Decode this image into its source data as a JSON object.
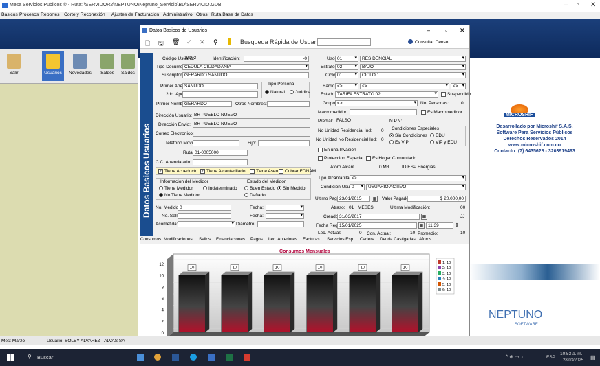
{
  "window": {
    "title": "Mesa Servicios Publicos ® - Ruta: \\SERVIDOR2\\NEPTUNO\\Neptuno_Servicio\\BD\\SERVICIO.GDB"
  },
  "menu": [
    "Basicos",
    "Procesos",
    "Reportes",
    "Corte y Reconexión",
    "Ajustes de Facturacion",
    "Administrativo",
    "Otros",
    "Ruta Base de Datos"
  ],
  "toolbar": [
    {
      "label": "Salir",
      "icon": "exit-icon"
    },
    {
      "label": "Usuarios",
      "icon": "users-icon"
    },
    {
      "label": "Novedades",
      "icon": "news-icon"
    },
    {
      "label": "Saldos",
      "icon": "balance-icon"
    },
    {
      "label": "Saldos",
      "icon": "balance-icon"
    }
  ],
  "dialog": {
    "title": "Datos Basicos de Usuarios",
    "quick_search_label": "Busqueda Rápida de Usuario",
    "consult_census": "Consultar Censo",
    "side_title": "Datos Basicos Usuarios",
    "left": {
      "codigo_label": "Código Usuario:",
      "codigo": "00002",
      "identificacion_label": "Identificación:",
      "ident_suffix": "-0",
      "tipo_doc_label": "Tipo Documento:",
      "tipo_doc": "CEDULA CIUDADANIA",
      "suscriptor_label": "Suscriptor:",
      "suscriptor": "GERARDO SAÑUDO",
      "primer_apellido_label": "Primer Apellido:",
      "primer_apellido": "SAÑUDO",
      "segundo_apellido_label": "2do. Apellido:",
      "primer_nombre_label": "Primer Nombre:",
      "primer_nombre": "GERARDO",
      "otros_nombres_label": "Otros Nombres:",
      "tipo_persona_label": "Tipo Persona",
      "natural": "Natural",
      "juridica": "Juridica",
      "direccion_label": "Dirección Usuario:",
      "direccion": "BR PUEBLO NUEVO",
      "envio_label": "Dirección Envio:",
      "envio": "BR PUEBLO NUEVO",
      "correo_label": "Correo Electronico:",
      "movil_label": "Teléfono Movil:",
      "fijo_label": "Fijo:",
      "ruta_label": "Ruta:",
      "ruta": "01-0005000",
      "cc_label": "C.C. Arrendatario:",
      "chk_acueducto": "Tiene Acueducto",
      "chk_alcantarillado": "Tiene Alcantarillado",
      "chk_aseo": "Tiene Aseo",
      "chk_fonam": "Cobrar FONAM",
      "info_medidor_label": "Informacion del Medidor",
      "tiene_medidor": "Tiene Medidor",
      "indeterminado": "Indeterminado",
      "no_tiene_medidor": "No Tiene Medidor",
      "estado_medidor_label": "Estado del Medidor",
      "buen_estado": "Buen Estado",
      "sin_medidor": "Sin Medidor",
      "danado": "Dañado",
      "no_medidor_label": "No. Medidor:",
      "no_medidor": "0",
      "fecha_label": "Fecha:",
      "no_sello_label": "No. Sello:",
      "acometida_label": "Acometida:",
      "diametro_label": "Diametro:"
    },
    "right": {
      "uso_label": "Uso:",
      "uso_code": "01",
      "uso": "RESIDENCIAL",
      "estrato_label": "Estrato:",
      "estrato_code": "02",
      "estrato": "BAJO",
      "ciclo_label": "Ciclo:",
      "ciclo_code": "01",
      "ciclo": "CICLO 1",
      "barrio_label": "Barrio:",
      "barrio_code": "<>",
      "barrio": "<>",
      "barrio_extra": "<>",
      "estado_label": "Estado:",
      "estado": "TARIFA ESTRATO 02",
      "suspendido": "Suspendido",
      "grupo_label": "Grupo:",
      "grupo": "<>",
      "no_personas_label": "No. Personas:",
      "no_personas": "0",
      "macromedidor_label": "Macromedidor:",
      "es_macromedidor": "Es Macromedidor",
      "predial_label": "Predial:",
      "predial": "FALSO",
      "npn_label": "N.P.N:",
      "no_unid_res_label": "No Unidad Residencial Ind:",
      "no_unid_res": "0",
      "no_unid_nores_label": "No Unidad No Residencial Ind:",
      "no_unid_nores": "0",
      "cond_esp_label": "Condiciones Especiales",
      "sin_condiciones": "Sin Condiciones",
      "edu": "EDU",
      "es_vip": "Es VIP",
      "vip_edu": "VIP y EDU",
      "en_invasion": "En una Invasión",
      "proteccion": "Proteccion Especial",
      "hogar_comunitario": "Es Hogar Comunitario",
      "aforo_label": "Aforo Alcant.",
      "aforo": "0 M3",
      "esp_energias": "ID ESP Energias:",
      "tipo_alc_label": "Tipo Alcantarillado:",
      "tipo_alc": "<>",
      "condicion_label": "Condicion Usuario:",
      "condicion_code": "0",
      "condicion": "USUARIO ACTIVO",
      "ultimo_pago_label": "Ultimo Pago:",
      "ultimo_pago": "23/01/2015",
      "valor_pagado_label": "Valor Pagado:",
      "valor_pagado": "$ 20.000,00",
      "atraso_label": "Atraso:",
      "atraso": "01",
      "meses": "MESES",
      "ultima_mod_label": "Ultima Modificación:",
      "ultima_mod": "00",
      "creado_label": "Creado:",
      "creado": "31/03/2017",
      "creado_extra": "JJ",
      "fecha_reg_label": "Fecha Reg:",
      "fecha_reg": "15/01/2025",
      "hora": "11:39",
      "lec_actual_label": "Lec. Actual:",
      "lec_actual": "0",
      "con_actual_label": "Con. Actual:",
      "con_actual": "10",
      "promedio_label": "Promedio:",
      "promedio": "10"
    },
    "tabs": [
      "Consumos",
      "Modificaciones",
      "Sellos",
      "Financiaciones",
      "Pagos",
      "Lec. Anteriores",
      "Facturas",
      "Servicios Esp.",
      "Cartera",
      "Deuda Castigadas",
      "Aforos"
    ]
  },
  "chart_data": {
    "type": "bar",
    "title": "Consumos Mensuales",
    "categories": [
      "1",
      "2",
      "3",
      "4",
      "5",
      "6"
    ],
    "values": [
      10,
      10,
      10,
      10,
      10,
      10
    ],
    "ylim": [
      0,
      12
    ],
    "yticks": [
      "0",
      "2",
      "4",
      "6",
      "8",
      "10",
      "12"
    ],
    "legend": [
      "1: 10",
      "2: 10",
      "3: 10",
      "4: 10",
      "5: 10",
      "6: 10"
    ],
    "legend_colors": [
      "#c0392b",
      "#8e44ad",
      "#27ae60",
      "#2980b9",
      "#d35400",
      "#7f8c8d"
    ]
  },
  "brand": {
    "logo": "MICROSHIF",
    "line1": "Desarrollado por Microshif S.A.S.",
    "line2": "Software Para Servicios Públicos",
    "line3": "Derechos Reservados 2014",
    "line4": "www.microshif.com.co",
    "line5": "Contacto: (7) 6435628 - 3203919493",
    "product": "NEPTUNO",
    "product_sub": "SOFTWARE"
  },
  "status": {
    "mes": "Mes: Marzo",
    "usuario": "Usuario: SOLEY ALVAREZ - ALVAS SA"
  },
  "taskbar": {
    "search": "Buscar",
    "lang": "ESP",
    "time": "10:53 a. m.",
    "date": "28/03/2025"
  }
}
